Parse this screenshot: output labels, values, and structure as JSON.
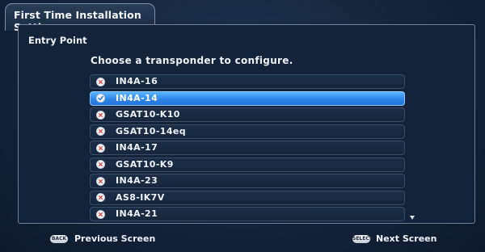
{
  "window": {
    "title": "First Time Installation Settings"
  },
  "panel": {
    "heading": "Entry Point",
    "instruction": "Choose a transponder to configure."
  },
  "transponders": [
    {
      "label": "IN4A-16",
      "status": "x-icon",
      "selected": false
    },
    {
      "label": "IN4A-14",
      "status": "check-icon",
      "selected": true
    },
    {
      "label": "GSAT10-K10",
      "status": "x-icon",
      "selected": false
    },
    {
      "label": "GSAT10-14eq",
      "status": "x-icon",
      "selected": false
    },
    {
      "label": "IN4A-17",
      "status": "x-icon",
      "selected": false
    },
    {
      "label": "GSAT10-K9",
      "status": "x-icon",
      "selected": false
    },
    {
      "label": "IN4A-23",
      "status": "x-icon",
      "selected": false
    },
    {
      "label": "AS8-IK7V",
      "status": "x-icon",
      "selected": false
    },
    {
      "label": "IN4A-21",
      "status": "x-icon",
      "selected": false
    }
  ],
  "footer": {
    "back_key": "BACK",
    "back_label": "Previous Screen",
    "select_key": "SELECT",
    "select_label": "Next Screen"
  },
  "colors": {
    "selection": "#2f86e8",
    "x_icon": "#e0453f",
    "check_icon": "#2a6fc9"
  }
}
